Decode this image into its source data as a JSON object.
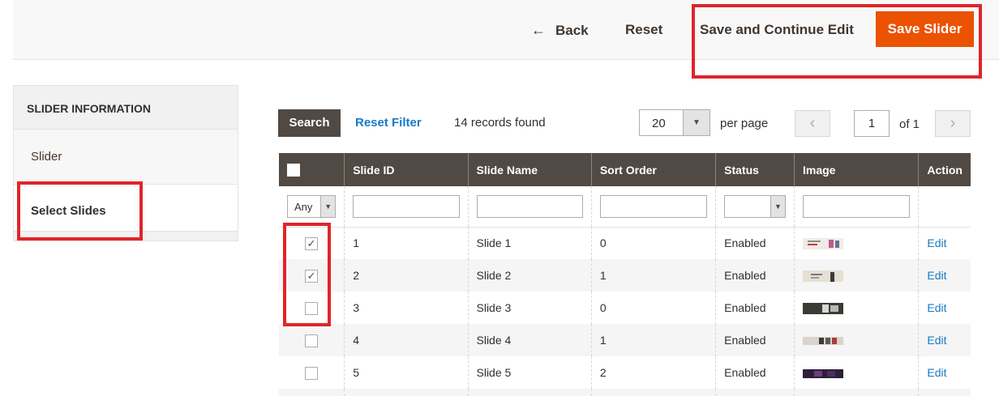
{
  "header": {
    "back_label": "Back",
    "reset_label": "Reset",
    "save_continue_label": "Save and Continue Edit",
    "save_slider_label": "Save Slider",
    "accent_color": "#eb5202"
  },
  "sidebar": {
    "title": "SLIDER INFORMATION",
    "items": [
      {
        "label": "Slider",
        "active": false
      },
      {
        "label": "Select Slides",
        "active": true
      }
    ]
  },
  "toolbar": {
    "search_label": "Search",
    "reset_filter_label": "Reset Filter",
    "records_found": "14 records found",
    "per_page_value": "20",
    "per_page_label": "per page",
    "current_page": "1",
    "of_pages": "of 1"
  },
  "grid": {
    "columns": [
      "Slide ID",
      "Slide Name",
      "Sort Order",
      "Status",
      "Image",
      "Action"
    ],
    "filter_any_label": "Any",
    "rows": [
      {
        "checked": true,
        "id": "1",
        "name": "Slide 1",
        "sort_order": "0",
        "status": "Enabled",
        "image_icon": "slide-thumbnail-light",
        "action": "Edit"
      },
      {
        "checked": true,
        "id": "2",
        "name": "Slide 2",
        "sort_order": "1",
        "status": "Enabled",
        "image_icon": "slide-thumbnail-beige",
        "action": "Edit"
      },
      {
        "checked": false,
        "id": "3",
        "name": "Slide 3",
        "sort_order": "0",
        "status": "Enabled",
        "image_icon": "slide-thumbnail-dark",
        "action": "Edit"
      },
      {
        "checked": false,
        "id": "4",
        "name": "Slide 4",
        "sort_order": "1",
        "status": "Enabled",
        "image_icon": "slide-thumbnail-mixed",
        "action": "Edit"
      },
      {
        "checked": false,
        "id": "5",
        "name": "Slide 5",
        "sort_order": "2",
        "status": "Enabled",
        "image_icon": "slide-thumbnail-purple",
        "action": "Edit"
      }
    ]
  },
  "annotation_color": "#e0242b"
}
